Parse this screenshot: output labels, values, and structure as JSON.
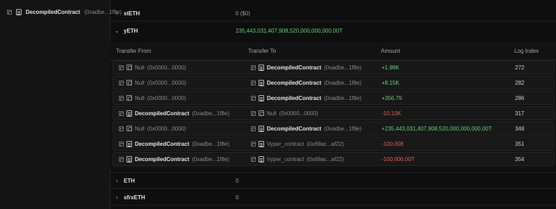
{
  "left": {
    "contract_name": "DecompiledContract",
    "contract_addr": "(0xadbe...1f8e)"
  },
  "tokens": [
    {
      "name": "stETH",
      "value": "0 ($0)",
      "expanded": false
    },
    {
      "name": "yETH",
      "value": "235,443,031,407,908,520,000,000,000.00T",
      "expanded": true
    },
    {
      "name": "ETH",
      "value": "0",
      "expanded": false
    },
    {
      "name": "sfrxETH",
      "value": "0",
      "expanded": false
    }
  ],
  "table": {
    "headers": {
      "from": "Transfer From",
      "to": "Transfer To",
      "amount": "Amount",
      "log": "Log Index"
    },
    "rows": [
      {
        "from_name": "Null",
        "from_addr": "(0x0000...0000)",
        "to_name": "DecompiledContract",
        "to_addr": "(0xadbe...1f8e)",
        "amount": "+1.98K",
        "log": "272"
      },
      {
        "from_name": "Null",
        "from_addr": "(0x0000...0000)",
        "to_name": "DecompiledContract",
        "to_addr": "(0xadbe...1f8e)",
        "amount": "+8.15K",
        "log": "282"
      },
      {
        "from_name": "Null",
        "from_addr": "(0x0000...0000)",
        "to_name": "DecompiledContract",
        "to_addr": "(0xadbe...1f8e)",
        "amount": "+356.79",
        "log": "286"
      },
      {
        "from_name": "DecompiledContract",
        "from_addr": "(0xadbe...1f8e)",
        "to_name": "Null",
        "to_addr": "(0x0000...0000)",
        "amount": "-10.10K",
        "log": "317"
      },
      {
        "from_name": "Null",
        "from_addr": "(0x0000...0000)",
        "to_name": "DecompiledContract",
        "to_addr": "(0xadbe...1f8e)",
        "amount": "+235,443,031,407,908,520,000,000,000.00T",
        "log": "348"
      },
      {
        "from_name": "DecompiledContract",
        "from_addr": "(0xadbe...1f8e)",
        "to_name": "Vyper_contract",
        "to_addr": "(0x69ac...af22)",
        "amount": "-100,008",
        "log": "351"
      },
      {
        "from_name": "DecompiledContract",
        "from_addr": "(0xadbe...1f8e)",
        "to_name": "Vyper_contract",
        "to_addr": "(0x69ac...af22)",
        "amount": "-100,000.00T",
        "log": "354"
      }
    ]
  }
}
